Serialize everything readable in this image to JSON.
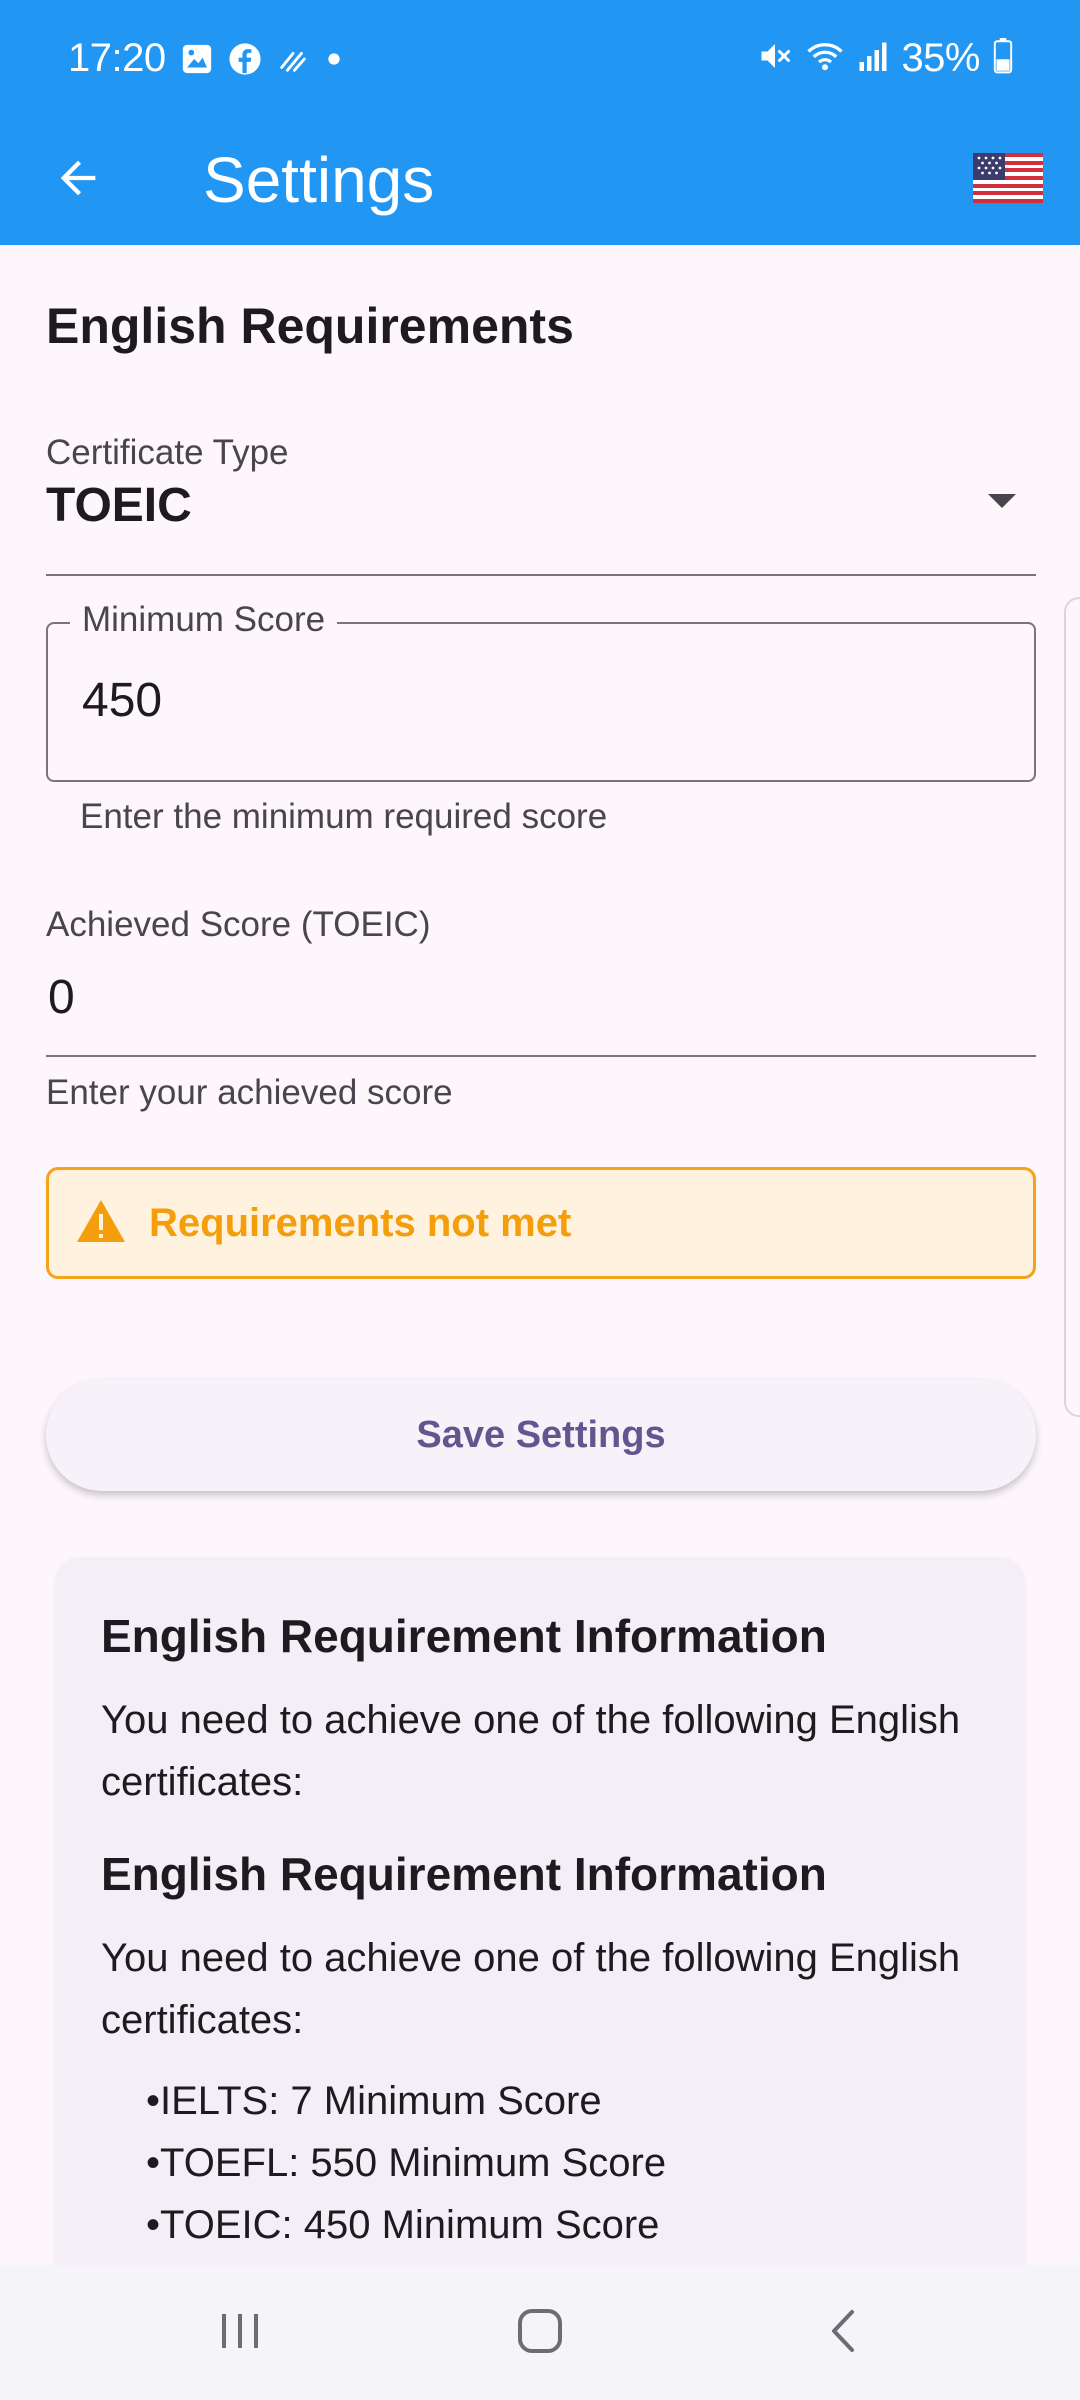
{
  "status_bar": {
    "time": "17:20",
    "battery": "35%",
    "left_icons": [
      "gallery-icon",
      "facebook-icon",
      "data-sync-icon",
      "dot-icon"
    ],
    "right_icons": [
      "mute-icon",
      "wifi-icon",
      "signal-icon",
      "battery-icon"
    ]
  },
  "app_bar": {
    "title": "Settings",
    "back_icon": "arrow-back-icon",
    "flag_icon": "us-flag-icon",
    "color": "#2196f3"
  },
  "section": {
    "title": "English Requirements"
  },
  "certificate_type": {
    "label": "Certificate Type",
    "value": "TOEIC"
  },
  "minimum_score": {
    "label": "Minimum Score",
    "value": "450",
    "helper": "Enter the minimum required score"
  },
  "achieved_score": {
    "label": "Achieved Score (TOEIC)",
    "value": "0",
    "helper": "Enter your achieved score"
  },
  "warning": {
    "text": "Requirements not met",
    "icon": "warning-icon",
    "color": "#f59e0b"
  },
  "save_button": {
    "label": "Save Settings"
  },
  "info_card": {
    "blocks": [
      {
        "title": "English Requirement Information",
        "body": "You need to achieve one of the following English certificates:"
      },
      {
        "title": "English Requirement Information",
        "body": "You need to achieve one of the following English certificates:"
      }
    ],
    "certificates": [
      "IELTS: 7 Minimum Score",
      "TOEFL: 550 Minimum Score",
      "TOEIC: 450 Minimum Score"
    ]
  },
  "nav_bar": {
    "recents_icon": "recents-icon",
    "home_icon": "home-icon",
    "back_icon": "nav-back-icon"
  }
}
